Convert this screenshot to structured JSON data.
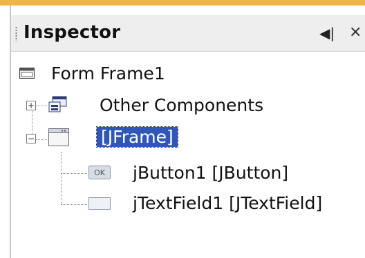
{
  "panel": {
    "title": "Inspector",
    "pin_icon": "pin-icon",
    "close_icon": "close-icon",
    "close_glyph": "×",
    "pin_glyph": "◀|"
  },
  "tree": {
    "root": {
      "label": "Form Frame1",
      "icon": "form-icon"
    },
    "nodes": [
      {
        "label": "Other Components",
        "icon": "components-icon",
        "expander": "+"
      },
      {
        "label": "[JFrame]",
        "icon": "jframe-icon",
        "expander": "−",
        "selected": true
      },
      {
        "label": "jButton1 [JButton]",
        "icon": "button-ok-icon",
        "icon_text": "OK"
      },
      {
        "label": "jTextField1 [JTextField]",
        "icon": "textfield-icon"
      }
    ]
  }
}
